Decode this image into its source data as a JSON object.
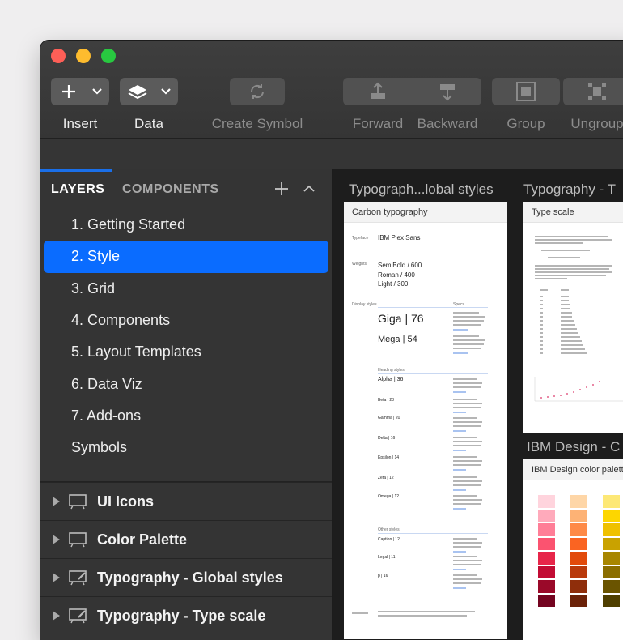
{
  "toolbar": {
    "insert": "Insert",
    "data": "Data",
    "create_symbol": "Create Symbol",
    "forward": "Forward",
    "backward": "Backward",
    "group": "Group",
    "ungroup": "Ungroup"
  },
  "sidebar": {
    "tabs": {
      "layers": "LAYERS",
      "components": "COMPONENTS"
    },
    "pages": [
      "1. Getting Started",
      "2. Style",
      "3. Grid",
      "4. Components",
      "5. Layout Templates",
      "6. Data Viz",
      "7. Add-ons",
      "Symbols"
    ],
    "selected_page": 1,
    "layers": [
      "UI Icons",
      "Color Palette",
      "Typography - Global styles",
      "Typography - Type scale"
    ]
  },
  "canvas": {
    "artboard_titles": [
      "Typograph...lobal styles",
      "Typography - T",
      "IBM Design - C"
    ],
    "board1": {
      "header": "Carbon typography",
      "typeface_label": "Typeface",
      "typeface": "IBM Plex Sans",
      "weights_label": "Weights",
      "weights": [
        "SemiBold / 600",
        "Roman / 400",
        "Light / 300"
      ],
      "display_label": "Display styles",
      "specs_label": "Specs",
      "display_styles": [
        "Giga | 76",
        "Mega | 54"
      ],
      "heading_label": "Heading styles",
      "heading_styles": [
        "Alpha | 36",
        "Beta | 28",
        "Gamma | 20",
        "Delta | 16",
        "Epsilon | 14",
        "Zeta | 12",
        "Omega | 12"
      ],
      "other_label": "Other styles",
      "other_styles": [
        "Caption | 12",
        "Legal | 11",
        "p | 16"
      ]
    },
    "board2": {
      "header": "Type scale"
    },
    "board3": {
      "header": "IBM Design color palett"
    }
  },
  "colors": {
    "accent": "#0a6cff",
    "reds": [
      "#ffd4dd",
      "#ffaabb",
      "#ff7e97",
      "#fb5370",
      "#e72549",
      "#c20c34",
      "#9a0929",
      "#740420"
    ],
    "oranges": [
      "#fed6a7",
      "#fdb275",
      "#fe8a47",
      "#fa6422",
      "#e24a0b",
      "#b93a0c",
      "#8f2e0b",
      "#6b2209"
    ],
    "yellows": [
      "#fde876",
      "#fdd600",
      "#efc100",
      "#c9a200",
      "#a88600",
      "#8b6e00",
      "#6a5400",
      "#4f3f00"
    ]
  }
}
